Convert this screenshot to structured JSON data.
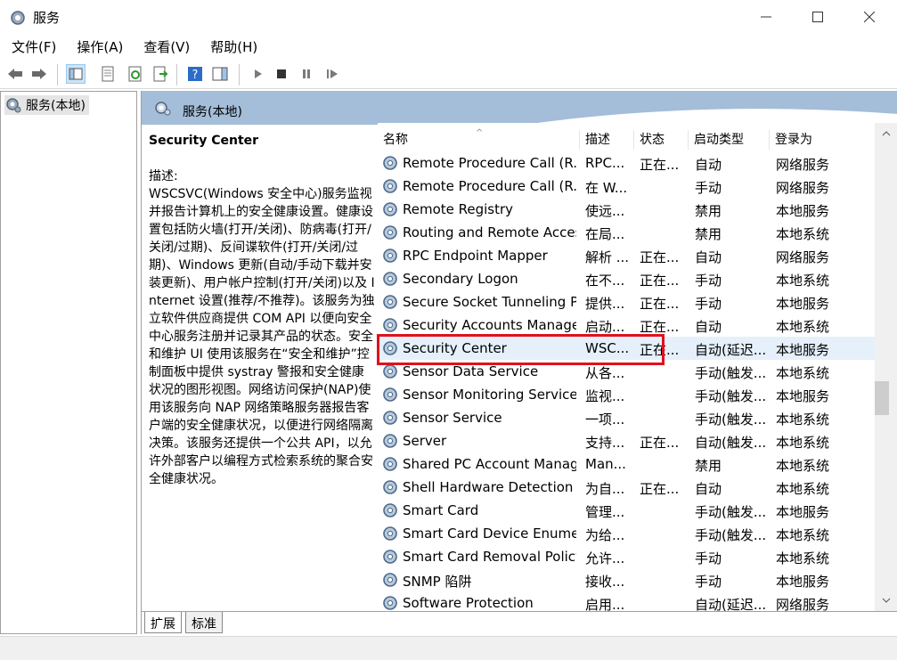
{
  "window": {
    "title": "服务"
  },
  "menu": [
    "文件(F)",
    "操作(A)",
    "查看(V)",
    "帮助(H)"
  ],
  "tree": {
    "root_label": "服务(本地)"
  },
  "panel": {
    "header": "服务(本地)",
    "selected_title": "Security Center",
    "desc_label": "描述:",
    "desc_body": "WSCSVC(Windows 安全中心)服务监视并报告计算机上的安全健康设置。健康设置包括防火墙(打开/关闭)、防病毒(打开/关闭/过期)、反间谍软件(打开/关闭/过期)、Windows 更新(自动/手动下载并安装更新)、用户帐户控制(打开/关闭)以及 Internet 设置(推荐/不推荐)。该服务为独立软件供应商提供 COM API 以便向安全中心服务注册并记录其产品的状态。安全和维护 UI 使用该服务在“安全和维护”控制面板中提供 systray 警报和安全健康状况的图形视图。网络访问保护(NAP)使用该服务向 NAP 网络策略服务器报告客户端的安全健康状况，以便进行网络隔离决策。该服务还提供一个公共 API，以允许外部客户以编程方式检索系统的聚合安全健康状况。"
  },
  "columns": {
    "name": "名称",
    "desc": "描述",
    "status": "状态",
    "startup": "启动类型",
    "logon": "登录为"
  },
  "rows": [
    {
      "name": "Remote Procedure Call (R...",
      "desc": "RPC...",
      "status": "正在...",
      "startup": "自动",
      "logon": "网络服务"
    },
    {
      "name": "Remote Procedure Call (R...",
      "desc": "在 W...",
      "status": "",
      "startup": "手动",
      "logon": "网络服务"
    },
    {
      "name": "Remote Registry",
      "desc": "使远...",
      "status": "",
      "startup": "禁用",
      "logon": "本地服务"
    },
    {
      "name": "Routing and Remote Access",
      "desc": "在局...",
      "status": "",
      "startup": "禁用",
      "logon": "本地系统"
    },
    {
      "name": "RPC Endpoint Mapper",
      "desc": "解析 ...",
      "status": "正在...",
      "startup": "自动",
      "logon": "网络服务"
    },
    {
      "name": "Secondary Logon",
      "desc": "在不...",
      "status": "正在...",
      "startup": "手动",
      "logon": "本地系统"
    },
    {
      "name": "Secure Socket Tunneling P...",
      "desc": "提供...",
      "status": "正在...",
      "startup": "手动",
      "logon": "本地服务"
    },
    {
      "name": "Security Accounts Manager",
      "desc": "启动...",
      "status": "正在...",
      "startup": "自动",
      "logon": "本地系统"
    },
    {
      "name": "Security Center",
      "desc": "WSC...",
      "status": "正在...",
      "startup": "自动(延迟...",
      "logon": "本地服务"
    },
    {
      "name": "Sensor Data Service",
      "desc": "从各...",
      "status": "",
      "startup": "手动(触发...",
      "logon": "本地系统"
    },
    {
      "name": "Sensor Monitoring Service",
      "desc": "监视...",
      "status": "",
      "startup": "手动(触发...",
      "logon": "本地服务"
    },
    {
      "name": "Sensor Service",
      "desc": "一项...",
      "status": "",
      "startup": "手动(触发...",
      "logon": "本地系统"
    },
    {
      "name": "Server",
      "desc": "支持...",
      "status": "正在...",
      "startup": "自动(触发...",
      "logon": "本地系统"
    },
    {
      "name": "Shared PC Account Manager",
      "desc": "Man...",
      "status": "",
      "startup": "禁用",
      "logon": "本地系统"
    },
    {
      "name": "Shell Hardware Detection",
      "desc": "为自...",
      "status": "正在...",
      "startup": "自动",
      "logon": "本地系统"
    },
    {
      "name": "Smart Card",
      "desc": "管理...",
      "status": "",
      "startup": "手动(触发...",
      "logon": "本地服务"
    },
    {
      "name": "Smart Card Device Enumer...",
      "desc": "为给...",
      "status": "",
      "startup": "手动(触发...",
      "logon": "本地系统"
    },
    {
      "name": "Smart Card Removal Policy",
      "desc": "允许...",
      "status": "",
      "startup": "手动",
      "logon": "本地系统"
    },
    {
      "name": "SNMP 陷阱",
      "desc": "接收...",
      "status": "",
      "startup": "手动",
      "logon": "本地服务"
    },
    {
      "name": "Software Protection",
      "desc": "启用...",
      "status": "",
      "startup": "自动(延迟...",
      "logon": "网络服务"
    }
  ],
  "selected_index": 8,
  "tabs": [
    "扩展",
    "标准"
  ],
  "colors": {
    "header_bg": "#a4bdd9",
    "highlight": "#e0111d"
  }
}
